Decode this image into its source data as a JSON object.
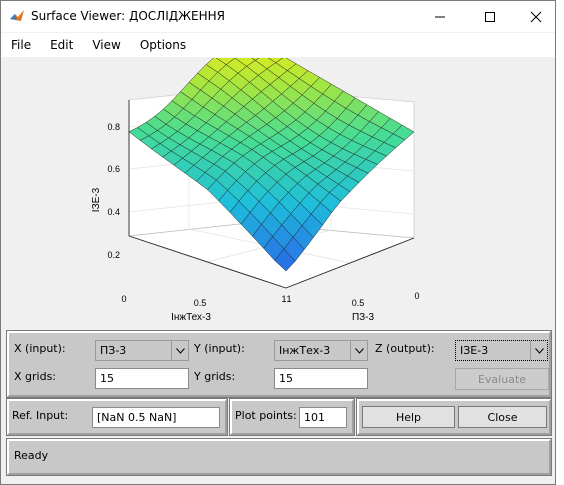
{
  "window": {
    "title": "Surface Viewer: ДОСЛІДЖЕННЯ"
  },
  "menu": [
    "File",
    "Edit",
    "View",
    "Options"
  ],
  "plot": {
    "z_label": "ІЗЕ-3",
    "x_label": "ІнжТех-3",
    "y_label": "ПЗ-3",
    "z_ticks": [
      "0.8",
      "0.6",
      "0.4",
      "0.2"
    ],
    "x_ticks": [
      "0",
      "0.5",
      "1"
    ],
    "y_ticks": [
      "1",
      "0.5",
      "0"
    ]
  },
  "controls": {
    "x_input_label": "X (input):",
    "x_input_value": "ПЗ-3",
    "y_input_label": "Y (input):",
    "y_input_value": "ІнжТех-3",
    "z_output_label": "Z (output):",
    "z_output_value": "ІЗЕ-3",
    "x_grids_label": "X grids:",
    "x_grids_value": "15",
    "y_grids_label": "Y grids:",
    "y_grids_value": "15",
    "evaluate_label": "Evaluate",
    "ref_input_label": "Ref. Input:",
    "ref_input_value": "[NaN 0.5 NaN]",
    "plot_points_label": "Plot points:",
    "plot_points_value": "101",
    "help_label": "Help",
    "close_label": "Close"
  },
  "status": {
    "text": "Ready"
  }
}
